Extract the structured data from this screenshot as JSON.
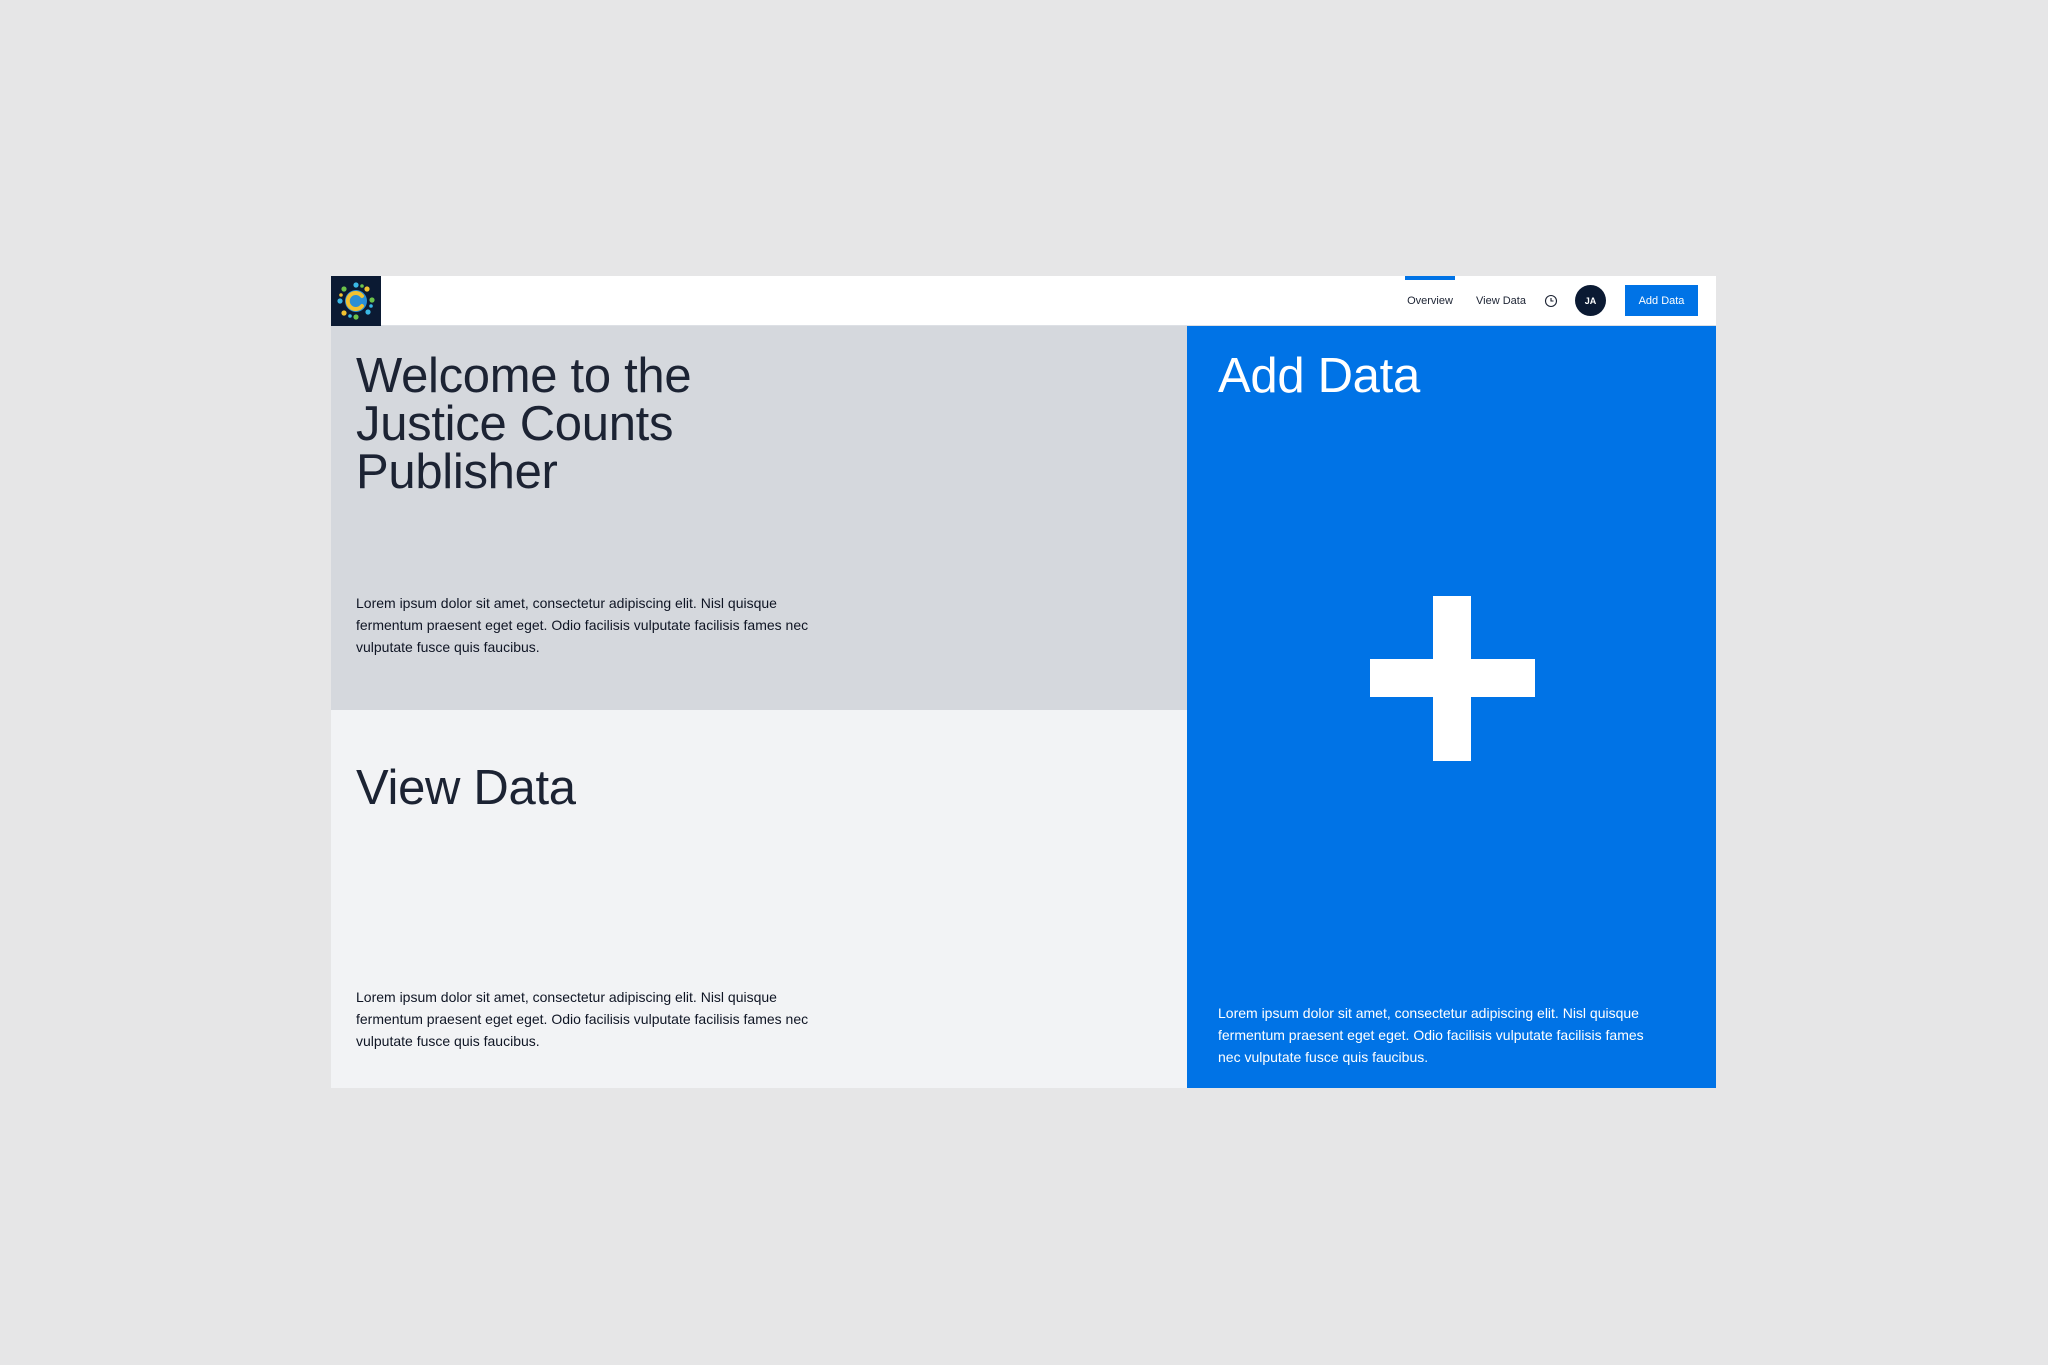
{
  "header": {
    "logo_icon": "justice-counts-logo-icon",
    "nav": {
      "overview_label": "Overview",
      "view_data_label": "View Data"
    },
    "clock_icon": "clock-icon",
    "avatar_initials": "JA",
    "add_data_button_label": "Add Data",
    "accent_color": "#0073e6"
  },
  "welcome": {
    "title": "Welcome to the Justice Counts Publisher",
    "description": "Lorem ipsum dolor sit amet, consectetur adipiscing elit. Nisl quisque fermentum praesent eget eget. Odio facilisis vulputate facilisis fames nec vulputate fusce quis faucibus."
  },
  "view_data": {
    "title": "View Data",
    "description": "Lorem ipsum dolor sit amet, consectetur adipiscing elit. Nisl quisque fermentum praesent eget eget. Odio facilisis vulputate facilisis fames nec vulputate fusce quis faucibus."
  },
  "add_data": {
    "title": "Add Data",
    "plus_icon": "plus-icon",
    "description": "Lorem ipsum dolor sit amet, consectetur adipiscing elit. Nisl quisque fermentum praesent eget eget. Odio facilisis vulputate facilisis fames nec vulputate fusce quis faucibus."
  }
}
